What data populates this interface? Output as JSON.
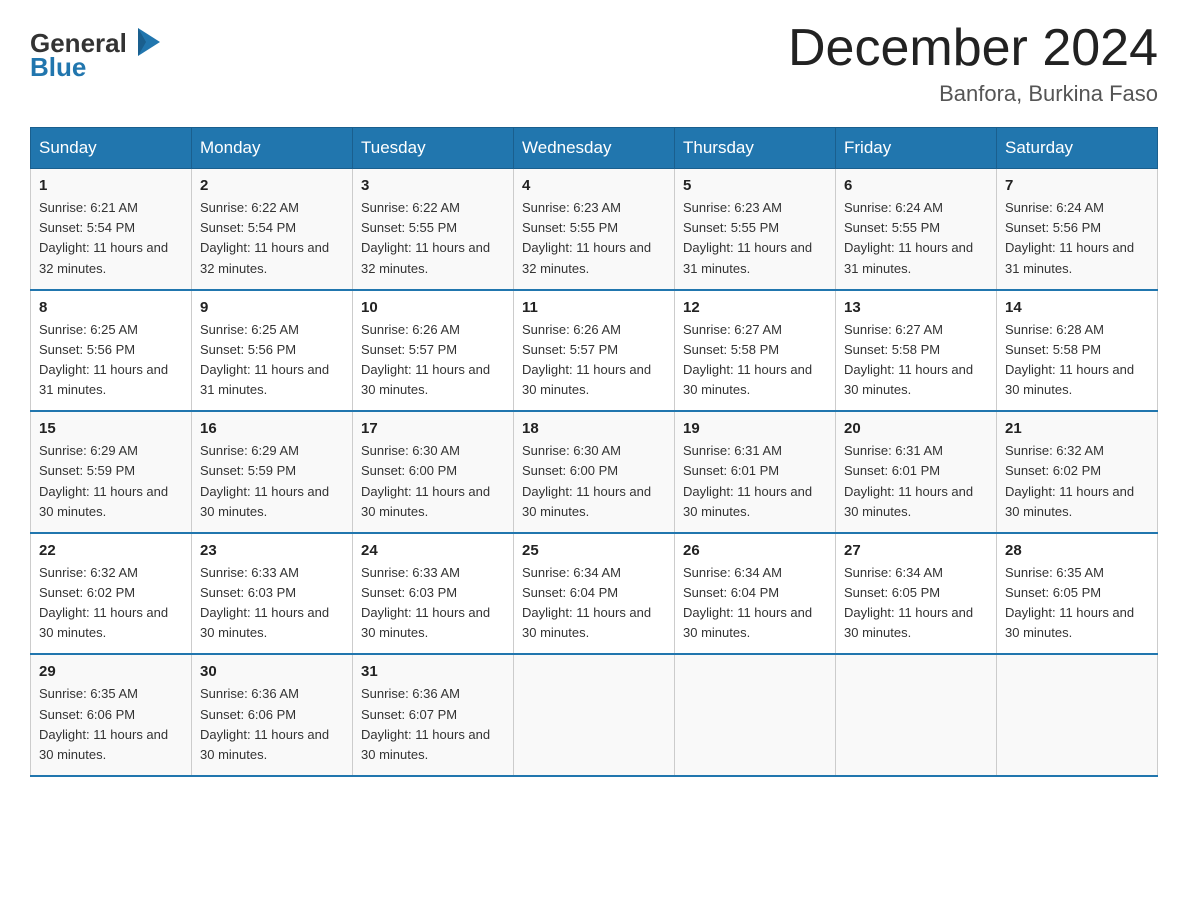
{
  "header": {
    "logo_general": "General",
    "logo_blue": "Blue",
    "month_title": "December 2024",
    "location": "Banfora, Burkina Faso"
  },
  "days_of_week": [
    "Sunday",
    "Monday",
    "Tuesday",
    "Wednesday",
    "Thursday",
    "Friday",
    "Saturday"
  ],
  "weeks": [
    [
      {
        "num": "1",
        "sunrise": "6:21 AM",
        "sunset": "5:54 PM",
        "daylight": "11 hours and 32 minutes."
      },
      {
        "num": "2",
        "sunrise": "6:22 AM",
        "sunset": "5:54 PM",
        "daylight": "11 hours and 32 minutes."
      },
      {
        "num": "3",
        "sunrise": "6:22 AM",
        "sunset": "5:55 PM",
        "daylight": "11 hours and 32 minutes."
      },
      {
        "num": "4",
        "sunrise": "6:23 AM",
        "sunset": "5:55 PM",
        "daylight": "11 hours and 32 minutes."
      },
      {
        "num": "5",
        "sunrise": "6:23 AM",
        "sunset": "5:55 PM",
        "daylight": "11 hours and 31 minutes."
      },
      {
        "num": "6",
        "sunrise": "6:24 AM",
        "sunset": "5:55 PM",
        "daylight": "11 hours and 31 minutes."
      },
      {
        "num": "7",
        "sunrise": "6:24 AM",
        "sunset": "5:56 PM",
        "daylight": "11 hours and 31 minutes."
      }
    ],
    [
      {
        "num": "8",
        "sunrise": "6:25 AM",
        "sunset": "5:56 PM",
        "daylight": "11 hours and 31 minutes."
      },
      {
        "num": "9",
        "sunrise": "6:25 AM",
        "sunset": "5:56 PM",
        "daylight": "11 hours and 31 minutes."
      },
      {
        "num": "10",
        "sunrise": "6:26 AM",
        "sunset": "5:57 PM",
        "daylight": "11 hours and 30 minutes."
      },
      {
        "num": "11",
        "sunrise": "6:26 AM",
        "sunset": "5:57 PM",
        "daylight": "11 hours and 30 minutes."
      },
      {
        "num": "12",
        "sunrise": "6:27 AM",
        "sunset": "5:58 PM",
        "daylight": "11 hours and 30 minutes."
      },
      {
        "num": "13",
        "sunrise": "6:27 AM",
        "sunset": "5:58 PM",
        "daylight": "11 hours and 30 minutes."
      },
      {
        "num": "14",
        "sunrise": "6:28 AM",
        "sunset": "5:58 PM",
        "daylight": "11 hours and 30 minutes."
      }
    ],
    [
      {
        "num": "15",
        "sunrise": "6:29 AM",
        "sunset": "5:59 PM",
        "daylight": "11 hours and 30 minutes."
      },
      {
        "num": "16",
        "sunrise": "6:29 AM",
        "sunset": "5:59 PM",
        "daylight": "11 hours and 30 minutes."
      },
      {
        "num": "17",
        "sunrise": "6:30 AM",
        "sunset": "6:00 PM",
        "daylight": "11 hours and 30 minutes."
      },
      {
        "num": "18",
        "sunrise": "6:30 AM",
        "sunset": "6:00 PM",
        "daylight": "11 hours and 30 minutes."
      },
      {
        "num": "19",
        "sunrise": "6:31 AM",
        "sunset": "6:01 PM",
        "daylight": "11 hours and 30 minutes."
      },
      {
        "num": "20",
        "sunrise": "6:31 AM",
        "sunset": "6:01 PM",
        "daylight": "11 hours and 30 minutes."
      },
      {
        "num": "21",
        "sunrise": "6:32 AM",
        "sunset": "6:02 PM",
        "daylight": "11 hours and 30 minutes."
      }
    ],
    [
      {
        "num": "22",
        "sunrise": "6:32 AM",
        "sunset": "6:02 PM",
        "daylight": "11 hours and 30 minutes."
      },
      {
        "num": "23",
        "sunrise": "6:33 AM",
        "sunset": "6:03 PM",
        "daylight": "11 hours and 30 minutes."
      },
      {
        "num": "24",
        "sunrise": "6:33 AM",
        "sunset": "6:03 PM",
        "daylight": "11 hours and 30 minutes."
      },
      {
        "num": "25",
        "sunrise": "6:34 AM",
        "sunset": "6:04 PM",
        "daylight": "11 hours and 30 minutes."
      },
      {
        "num": "26",
        "sunrise": "6:34 AM",
        "sunset": "6:04 PM",
        "daylight": "11 hours and 30 minutes."
      },
      {
        "num": "27",
        "sunrise": "6:34 AM",
        "sunset": "6:05 PM",
        "daylight": "11 hours and 30 minutes."
      },
      {
        "num": "28",
        "sunrise": "6:35 AM",
        "sunset": "6:05 PM",
        "daylight": "11 hours and 30 minutes."
      }
    ],
    [
      {
        "num": "29",
        "sunrise": "6:35 AM",
        "sunset": "6:06 PM",
        "daylight": "11 hours and 30 minutes."
      },
      {
        "num": "30",
        "sunrise": "6:36 AM",
        "sunset": "6:06 PM",
        "daylight": "11 hours and 30 minutes."
      },
      {
        "num": "31",
        "sunrise": "6:36 AM",
        "sunset": "6:07 PM",
        "daylight": "11 hours and 30 minutes."
      },
      null,
      null,
      null,
      null
    ]
  ]
}
